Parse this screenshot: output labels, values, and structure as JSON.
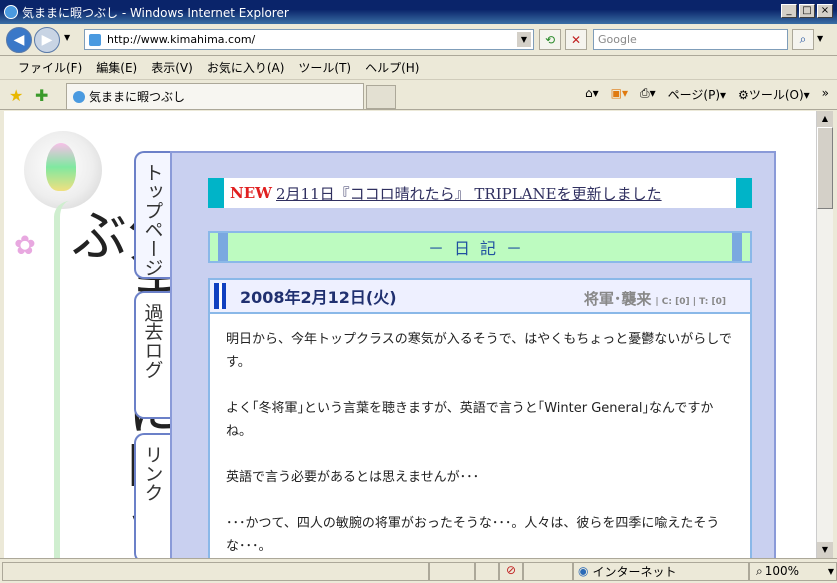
{
  "window": {
    "title": "気ままに暇つぶし - Windows Internet Explorer",
    "buttons": [
      "_",
      "□",
      "×"
    ]
  },
  "toolbar": {
    "url": "http://www.kimahima.com/",
    "search_placeholder": "Google"
  },
  "menu": [
    "ファイル(F)",
    "編集(E)",
    "表示(V)",
    "お気に入り(A)",
    "ツール(T)",
    "ヘルプ(H)"
  ],
  "tabs": {
    "active_label": "気ままに暇つぶし"
  },
  "commandbar": {
    "page": "ページ(P)",
    "tools": "ツール(O)"
  },
  "site": {
    "logo_text": "気ままに暇つぶ",
    "side_tabs": [
      "トップページ",
      "過去ログ",
      "リンク"
    ],
    "news_prefix": "NEW",
    "news_text": "2月11日『ココロ晴れたら』 TRIPLANEを更新しました",
    "diary_header": "－日記－",
    "entry": {
      "date": "2008年2月12日(火)",
      "category": "将軍･襲来",
      "meta": "| C: [0] | T: [0]",
      "paragraphs": [
        "明日から、今年トップクラスの寒気が入るそうで、はやくもちょっと憂鬱ないがらしです。",
        "よく｢冬将軍｣という言葉を聴きますが、英語で言うと｢Winter General｣なんですかね。",
        "英語で言う必要があるとは思えませんが･･･",
        "･･･かつて、四人の敏腕の将軍がおったそうな･･･。人々は、彼らを四季に喩えたそうな･･･。"
      ]
    }
  },
  "status": {
    "zone": "インターネット",
    "zoom": "100%"
  }
}
